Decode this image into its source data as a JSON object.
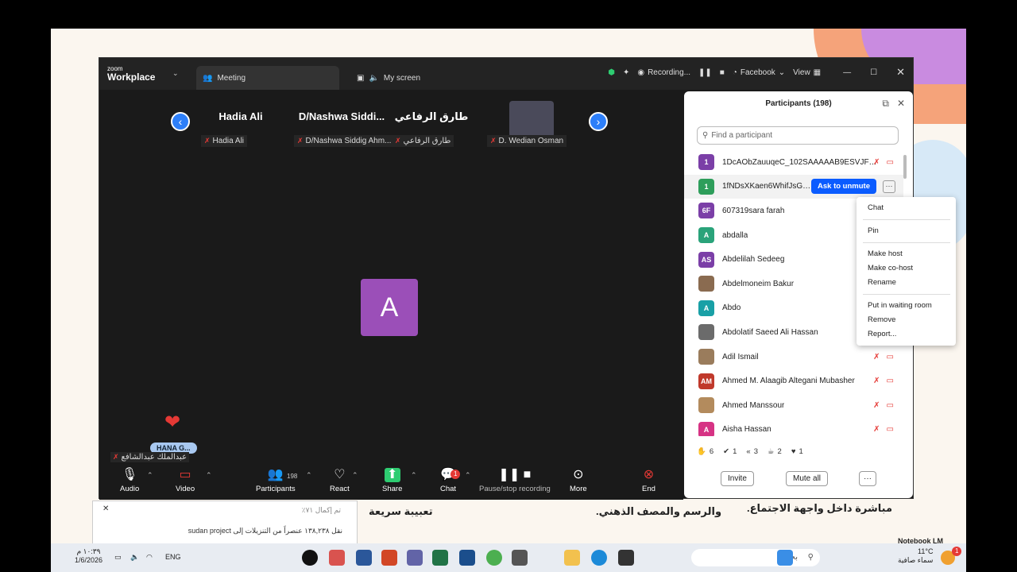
{
  "window": {
    "brand_small": "zoom",
    "brand_big": "Workplace"
  },
  "tabs": [
    {
      "label": "Meeting"
    },
    {
      "label": "My screen"
    }
  ],
  "titlebar": {
    "recording": "Recording...",
    "facebook": "Facebook",
    "view": "View"
  },
  "gallery": [
    {
      "name": "Hadia Ali",
      "label": "Hadia Ali"
    },
    {
      "name": "D/Nashwa  Siddi...",
      "label": "D/Nashwa Siddig Ahm..."
    },
    {
      "name": "طارق الرفاعي",
      "label": "طارق الرفاعي"
    },
    {
      "name": "",
      "label": "D. Wedian Osman"
    }
  ],
  "main": {
    "avatar_letter": "A",
    "hana": "HANA G...",
    "speaker": "عبدالملك عبدالشافع"
  },
  "toolbar": {
    "audio": "Audio",
    "video": "Video",
    "participants": "Participants",
    "participants_count": "198",
    "react": "React",
    "share": "Share",
    "chat": "Chat",
    "chat_badge": "1",
    "recording": "Pause/stop recording",
    "more": "More",
    "end": "End"
  },
  "panel": {
    "title": "Participants (198)",
    "search_placeholder": "Find a participant",
    "ask_unmute": "Ask to unmute",
    "participants": [
      {
        "initials": "1",
        "color": "#7b3fa7",
        "name": "1DcAObZauuqeC_102SAAAAAB9ESVJFQ1..."
      },
      {
        "initials": "1",
        "color": "#2e9e5b",
        "name": "1fNDsXKaen6WhifJsGQ4..."
      },
      {
        "initials": "6F",
        "color": "#7b3fa7",
        "name": "607319sara farah"
      },
      {
        "initials": "A",
        "color": "#2aa37a",
        "name": "abdalla"
      },
      {
        "initials": "AS",
        "color": "#7b3fa7",
        "name": "Abdelilah Sedeeg"
      },
      {
        "initials": "",
        "color": "#8a6b50",
        "name": "Abdelmoneim Bakur"
      },
      {
        "initials": "A",
        "color": "#19a0a6",
        "name": "Abdo"
      },
      {
        "initials": "",
        "color": "#6b6b6b",
        "name": "Abdolatif Saeed Ali Hassan"
      },
      {
        "initials": "",
        "color": "#9a7c5c",
        "name": "Adil Ismail"
      },
      {
        "initials": "AM",
        "color": "#c0392b",
        "name": "Ahmed M. Alaagib Altegani Mubasher"
      },
      {
        "initials": "",
        "color": "#b38b5d",
        "name": "Ahmed Manssour"
      },
      {
        "initials": "A",
        "color": "#d63384",
        "name": "Aisha Hassan"
      }
    ],
    "reactions": [
      {
        "icon": "✋",
        "count": "6"
      },
      {
        "icon": "✔",
        "count": "1"
      },
      {
        "icon": "«",
        "count": "3"
      },
      {
        "icon": "☕",
        "count": "2"
      },
      {
        "icon": "♥",
        "count": "1"
      }
    ],
    "invite": "Invite",
    "mute_all": "Mute all",
    "more": "···"
  },
  "context_menu": [
    "Chat",
    "Pin",
    "Make host",
    "Make co-host",
    "Rename",
    "Put in waiting room",
    "Remove",
    "Report..."
  ],
  "background": {
    "text1": "مباشرة داخل واجهة الاجتماع.",
    "text2": "والرسم والمصف الذهني.",
    "text3": "تعبيبة سريعة",
    "brand": "Notebook LM"
  },
  "notification": {
    "line1": "نقل ١٣٨,٢٣٨ عنصراً من التنزيلات إلى sudan project",
    "line2": "تم إكمال ٧١٪"
  },
  "taskbar": {
    "time": "١٠:٣٩ م",
    "date": "1/6/2026",
    "lang": "ENG",
    "search": "بحث",
    "weather_temp": "11°C",
    "weather_desc": "سماء صافية",
    "notif_count": "1"
  }
}
